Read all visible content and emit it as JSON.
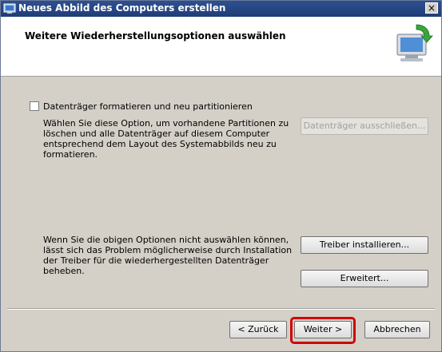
{
  "window": {
    "title": "Neues Abbild des Computers erstellen",
    "close_label": "×"
  },
  "header": {
    "title": "Weitere Wiederherstellungsoptionen auswählen"
  },
  "options": {
    "format_checkbox_label": "Datenträger formatieren und neu partitionieren",
    "format_checked": false,
    "format_description": "Wählen Sie diese Option, um vorhandene Partitionen zu löschen und alle Datenträger auf diesem Computer entsprechend dem Layout des Systemabbilds neu zu formatieren.",
    "exclude_disks_label": "Datenträger ausschließen..."
  },
  "drivers": {
    "hint": "Wenn Sie die obigen Optionen nicht auswählen können, lässt sich das Problem möglicherweise durch Installation der Treiber für die wiederhergestellten Datenträger beheben.",
    "install_label": "Treiber installieren...",
    "advanced_label": "Erweitert..."
  },
  "footer": {
    "back_label": "< Zurück",
    "next_label": "Weiter >",
    "cancel_label": "Abbrechen"
  },
  "colors": {
    "titlebar": "#1f3d78",
    "highlight": "#d20000"
  }
}
